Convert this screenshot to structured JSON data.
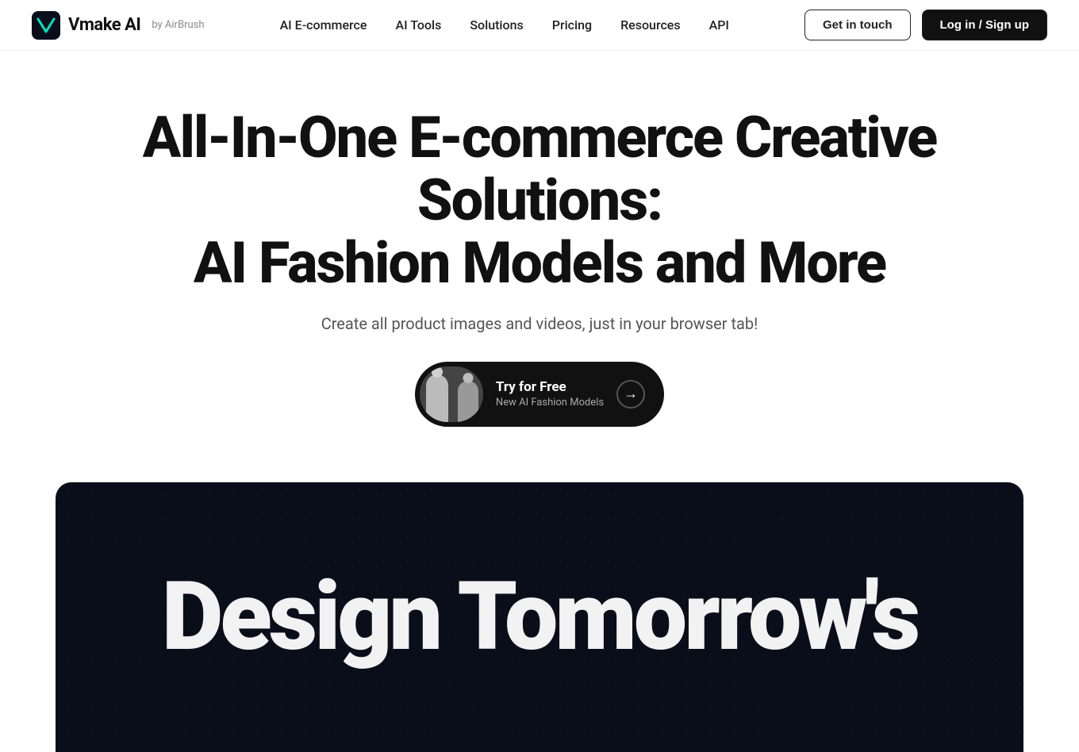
{
  "logo": {
    "icon_label": "vmake-logo-icon",
    "brand_name": "Vmake AI",
    "by_text": "by AirBrush"
  },
  "nav": {
    "links": [
      {
        "id": "ai-ecommerce",
        "label": "AI E-commerce"
      },
      {
        "id": "ai-tools",
        "label": "AI Tools"
      },
      {
        "id": "solutions",
        "label": "Solutions"
      },
      {
        "id": "pricing",
        "label": "Pricing"
      },
      {
        "id": "resources",
        "label": "Resources"
      },
      {
        "id": "api",
        "label": "API"
      }
    ],
    "get_in_touch_label": "Get in touch",
    "log_in_label": "Log in / Sign up"
  },
  "hero": {
    "title_line1": "All-In-One E-commerce Creative Solutions:",
    "title_line2": "AI Fashion Models and More",
    "subtitle": "Create all product images and videos, just in your browser tab!",
    "cta": {
      "main_text": "Try for Free",
      "sub_text": "New AI Fashion Models",
      "arrow_symbol": "→"
    }
  },
  "dark_section": {
    "big_text_line1": "Design Tomorrow's"
  }
}
